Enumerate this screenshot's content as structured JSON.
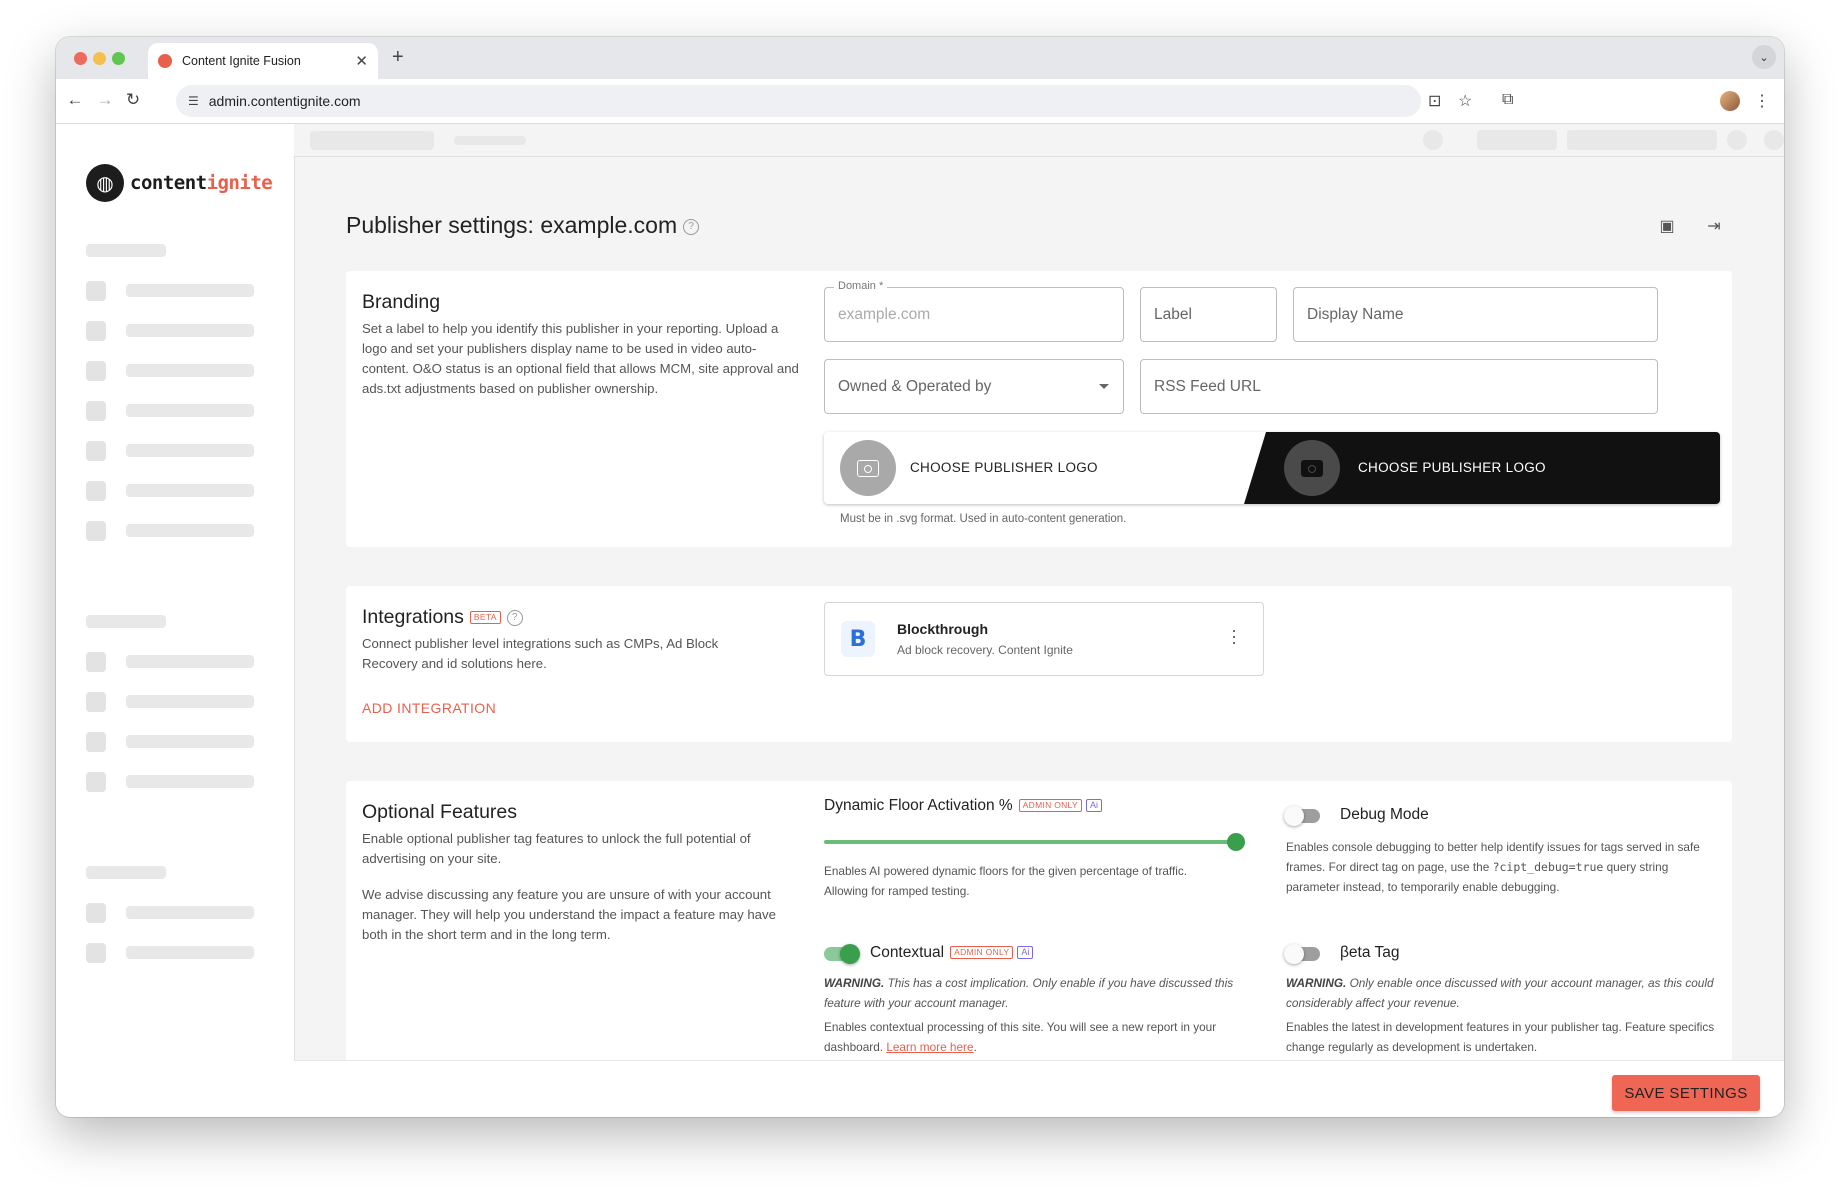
{
  "browser": {
    "tab_title": "Content Ignite Fusion",
    "new_tab": "+",
    "url": "admin.contentignite.com"
  },
  "logo": {
    "part1": "content",
    "part2": "ignite"
  },
  "page": {
    "title": "Publisher settings: example.com"
  },
  "branding": {
    "title": "Branding",
    "description": "Set a label to help you identify this publisher in your reporting. Upload a logo and set your publishers display name to be used in video auto-content. O&O status is an optional field that allows MCM, site approval and ads.txt adjustments based on publisher ownership.",
    "domain_legend": "Domain *",
    "domain_placeholder": "example.com",
    "label_placeholder": "Label",
    "display_name_placeholder": "Display Name",
    "owned_operated_label": "Owned & Operated by",
    "rss_placeholder": "RSS Feed URL",
    "logo_light_label": "CHOOSE PUBLISHER LOGO",
    "logo_dark_label": "CHOOSE PUBLISHER LOGO",
    "logo_hint": "Must be in .svg format. Used in auto-content generation."
  },
  "integrations": {
    "title": "Integrations",
    "badge": "BETA",
    "description": "Connect publisher level integrations such as CMPs, Ad Block Recovery and id solutions here.",
    "add_label": "ADD INTEGRATION",
    "items": [
      {
        "name": "Blockthrough",
        "subtitle": "Ad block recovery. Content Ignite"
      }
    ]
  },
  "optional_features": {
    "title": "Optional Features",
    "description_1": "Enable optional publisher tag features to unlock the full potential of advertising on your site.",
    "description_2": "We advise discussing any feature you are unsure of with your account manager. They will help you understand the impact a feature may have both in the short term and in the long term.",
    "dynamic_floor": {
      "label": "Dynamic Floor Activation %",
      "badge": "ADMIN ONLY",
      "ai_badge": "Ai",
      "value_percent": 100,
      "text": "Enables AI powered dynamic floors for the given percentage of traffic. Allowing for ramped testing."
    },
    "debug_mode": {
      "label": "Debug Mode",
      "enabled": false,
      "text_1": "Enables console debugging to better help identify issues for tags served in safe frames. For direct tag on page, use the",
      "code": "?cipt_debug=true",
      "text_2": "query string parameter instead, to temporarily enable debugging."
    },
    "contextual": {
      "label": "Contextual",
      "badge": "ADMIN ONLY",
      "ai_badge": "Ai",
      "enabled": true,
      "warning_label": "WARNING.",
      "warning_text": "This has a cost implication. Only enable if you have discussed this feature with your account manager.",
      "text": "Enables contextual processing of this site. You will see a new report in your dashboard.",
      "link": "Learn more here",
      "period": "."
    },
    "beta_tag": {
      "label": "βeta Tag",
      "enabled": false,
      "warning_label": "WARNING.",
      "warning_text": "Only enable once discussed with your account manager, as this could considerably affect your revenue.",
      "text": "Enables the latest in development features in your publisher tag. Feature specifics change regularly as development is undertaken."
    }
  },
  "footer": {
    "save_label": "SAVE SETTINGS"
  },
  "colors": {
    "accent": "#e8604c",
    "toggle_on": "#3a9f4d",
    "dark_panel": "#111111"
  }
}
